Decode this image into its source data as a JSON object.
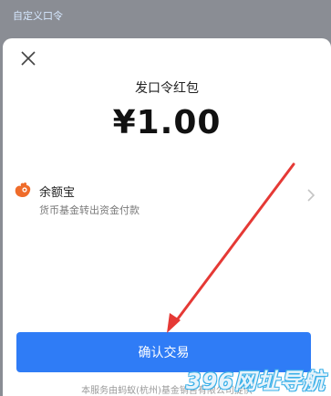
{
  "backdrop": {
    "title": "自定义口令"
  },
  "sheet": {
    "title": "发口令红包",
    "amount": "¥1.00",
    "payment": {
      "name": "余额宝",
      "description": "货币基金转出资金付款",
      "icon": "yuebao-logo-icon"
    },
    "confirm_label": "确认交易",
    "footer": "本服务由蚂蚁(杭州)基金销售有限公司提供"
  },
  "watermark": {
    "text": "396网址导航"
  },
  "colors": {
    "primary": "#2f7cf6",
    "annotation_arrow": "#e53935"
  }
}
